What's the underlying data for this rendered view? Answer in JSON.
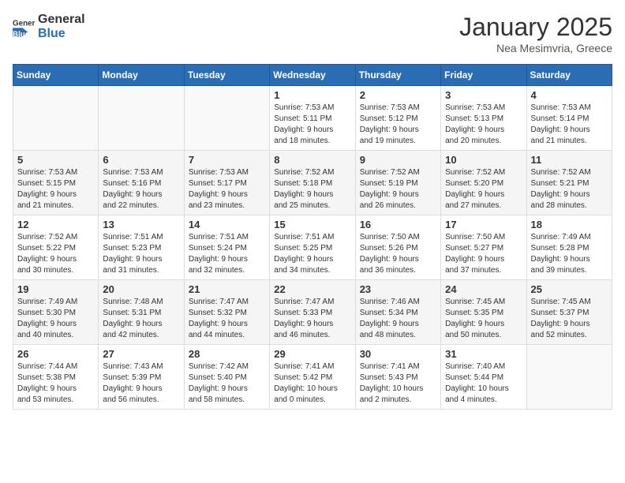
{
  "header": {
    "logo_general": "General",
    "logo_blue": "Blue",
    "month": "January 2025",
    "location": "Nea Mesimvria, Greece"
  },
  "days_of_week": [
    "Sunday",
    "Monday",
    "Tuesday",
    "Wednesday",
    "Thursday",
    "Friday",
    "Saturday"
  ],
  "weeks": [
    [
      {
        "day": "",
        "info": ""
      },
      {
        "day": "",
        "info": ""
      },
      {
        "day": "",
        "info": ""
      },
      {
        "day": "1",
        "info": "Sunrise: 7:53 AM\nSunset: 5:11 PM\nDaylight: 9 hours\nand 18 minutes."
      },
      {
        "day": "2",
        "info": "Sunrise: 7:53 AM\nSunset: 5:12 PM\nDaylight: 9 hours\nand 19 minutes."
      },
      {
        "day": "3",
        "info": "Sunrise: 7:53 AM\nSunset: 5:13 PM\nDaylight: 9 hours\nand 20 minutes."
      },
      {
        "day": "4",
        "info": "Sunrise: 7:53 AM\nSunset: 5:14 PM\nDaylight: 9 hours\nand 21 minutes."
      }
    ],
    [
      {
        "day": "5",
        "info": "Sunrise: 7:53 AM\nSunset: 5:15 PM\nDaylight: 9 hours\nand 21 minutes."
      },
      {
        "day": "6",
        "info": "Sunrise: 7:53 AM\nSunset: 5:16 PM\nDaylight: 9 hours\nand 22 minutes."
      },
      {
        "day": "7",
        "info": "Sunrise: 7:53 AM\nSunset: 5:17 PM\nDaylight: 9 hours\nand 23 minutes."
      },
      {
        "day": "8",
        "info": "Sunrise: 7:52 AM\nSunset: 5:18 PM\nDaylight: 9 hours\nand 25 minutes."
      },
      {
        "day": "9",
        "info": "Sunrise: 7:52 AM\nSunset: 5:19 PM\nDaylight: 9 hours\nand 26 minutes."
      },
      {
        "day": "10",
        "info": "Sunrise: 7:52 AM\nSunset: 5:20 PM\nDaylight: 9 hours\nand 27 minutes."
      },
      {
        "day": "11",
        "info": "Sunrise: 7:52 AM\nSunset: 5:21 PM\nDaylight: 9 hours\nand 28 minutes."
      }
    ],
    [
      {
        "day": "12",
        "info": "Sunrise: 7:52 AM\nSunset: 5:22 PM\nDaylight: 9 hours\nand 30 minutes."
      },
      {
        "day": "13",
        "info": "Sunrise: 7:51 AM\nSunset: 5:23 PM\nDaylight: 9 hours\nand 31 minutes."
      },
      {
        "day": "14",
        "info": "Sunrise: 7:51 AM\nSunset: 5:24 PM\nDaylight: 9 hours\nand 32 minutes."
      },
      {
        "day": "15",
        "info": "Sunrise: 7:51 AM\nSunset: 5:25 PM\nDaylight: 9 hours\nand 34 minutes."
      },
      {
        "day": "16",
        "info": "Sunrise: 7:50 AM\nSunset: 5:26 PM\nDaylight: 9 hours\nand 36 minutes."
      },
      {
        "day": "17",
        "info": "Sunrise: 7:50 AM\nSunset: 5:27 PM\nDaylight: 9 hours\nand 37 minutes."
      },
      {
        "day": "18",
        "info": "Sunrise: 7:49 AM\nSunset: 5:28 PM\nDaylight: 9 hours\nand 39 minutes."
      }
    ],
    [
      {
        "day": "19",
        "info": "Sunrise: 7:49 AM\nSunset: 5:30 PM\nDaylight: 9 hours\nand 40 minutes."
      },
      {
        "day": "20",
        "info": "Sunrise: 7:48 AM\nSunset: 5:31 PM\nDaylight: 9 hours\nand 42 minutes."
      },
      {
        "day": "21",
        "info": "Sunrise: 7:47 AM\nSunset: 5:32 PM\nDaylight: 9 hours\nand 44 minutes."
      },
      {
        "day": "22",
        "info": "Sunrise: 7:47 AM\nSunset: 5:33 PM\nDaylight: 9 hours\nand 46 minutes."
      },
      {
        "day": "23",
        "info": "Sunrise: 7:46 AM\nSunset: 5:34 PM\nDaylight: 9 hours\nand 48 minutes."
      },
      {
        "day": "24",
        "info": "Sunrise: 7:45 AM\nSunset: 5:35 PM\nDaylight: 9 hours\nand 50 minutes."
      },
      {
        "day": "25",
        "info": "Sunrise: 7:45 AM\nSunset: 5:37 PM\nDaylight: 9 hours\nand 52 minutes."
      }
    ],
    [
      {
        "day": "26",
        "info": "Sunrise: 7:44 AM\nSunset: 5:38 PM\nDaylight: 9 hours\nand 53 minutes."
      },
      {
        "day": "27",
        "info": "Sunrise: 7:43 AM\nSunset: 5:39 PM\nDaylight: 9 hours\nand 56 minutes."
      },
      {
        "day": "28",
        "info": "Sunrise: 7:42 AM\nSunset: 5:40 PM\nDaylight: 9 hours\nand 58 minutes."
      },
      {
        "day": "29",
        "info": "Sunrise: 7:41 AM\nSunset: 5:42 PM\nDaylight: 10 hours\nand 0 minutes."
      },
      {
        "day": "30",
        "info": "Sunrise: 7:41 AM\nSunset: 5:43 PM\nDaylight: 10 hours\nand 2 minutes."
      },
      {
        "day": "31",
        "info": "Sunrise: 7:40 AM\nSunset: 5:44 PM\nDaylight: 10 hours\nand 4 minutes."
      },
      {
        "day": "",
        "info": ""
      }
    ]
  ]
}
